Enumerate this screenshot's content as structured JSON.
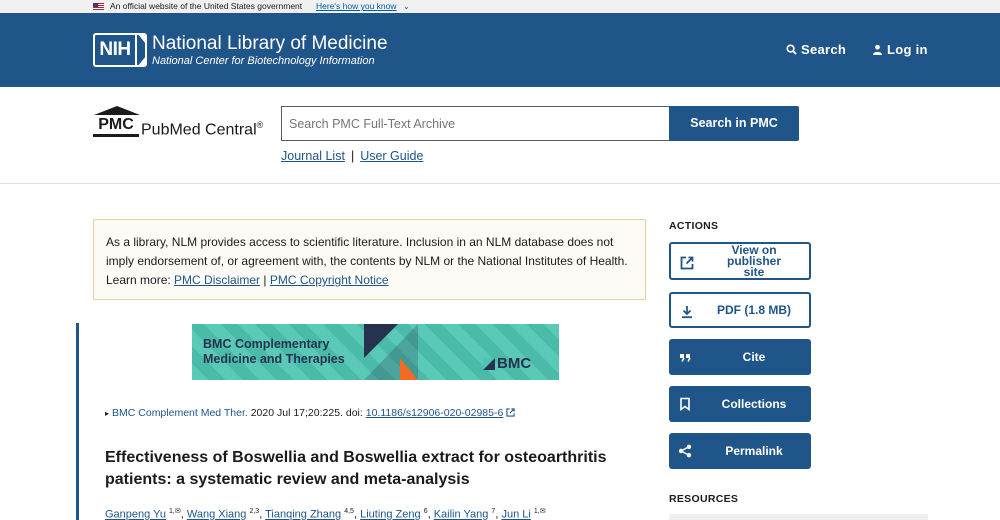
{
  "gov_banner": {
    "text": "An official website of the United States government",
    "link": "Here's how you know",
    "chevron": "⌄"
  },
  "header": {
    "logo_text": "NIH",
    "title": "National Library of Medicine",
    "subtitle": "National Center for Biotechnology Information",
    "search_label": "Search",
    "login_label": "Log in"
  },
  "pmc": {
    "logo_text": "PMC",
    "name": "PubMed Central",
    "registered": "®",
    "search_placeholder": "Search PMC Full-Text Archive",
    "search_button": "Search in PMC",
    "journal_list": "Journal List",
    "separator": "|",
    "user_guide": "User Guide"
  },
  "notice": {
    "text": "As a library, NLM provides access to scientific literature. Inclusion in an NLM database does not imply endorsement of, or agreement with, the contents by NLM or the National Institutes of Health. Learn more: ",
    "link1": "PMC Disclaimer",
    "sep": " | ",
    "link2": "PMC Copyright Notice"
  },
  "journal_banner": {
    "line1": "BMC Complementary",
    "line2": "Medicine and Therapies",
    "brand": "BMC"
  },
  "citation": {
    "caret": "▸",
    "journal": "BMC Complement Med Ther.",
    "details": " 2020 Jul 17;20:225. doi: ",
    "doi": "10.1186/s12906-020-02985-6"
  },
  "article": {
    "title": "Effectiveness of Boswellia and Boswellia extract for osteoarthritis patients: a systematic review and meta-analysis",
    "authors": [
      {
        "name": "Ganpeng Yu",
        "sup": "1,✉"
      },
      {
        "name": "Wang Xiang",
        "sup": "2,3"
      },
      {
        "name": "Tianqing Zhang",
        "sup": "4,5"
      },
      {
        "name": "Liuting Zeng",
        "sup": "6"
      },
      {
        "name": "Kailin Yang",
        "sup": "7"
      },
      {
        "name": "Jun Li",
        "sup": "1,✉"
      }
    ]
  },
  "actions": {
    "heading": "ACTIONS",
    "view_publisher": "View on publisher site",
    "pdf": "PDF (1.8 MB)",
    "cite": "Cite",
    "collections": "Collections",
    "permalink": "Permalink",
    "resources_heading": "RESOURCES"
  },
  "colors": {
    "header_blue": "#20558a",
    "notice_border": "#e9cf9e",
    "banner_teal": "#4ec5b2",
    "banner_orange": "#f26b21",
    "banner_navy": "#27324f"
  }
}
